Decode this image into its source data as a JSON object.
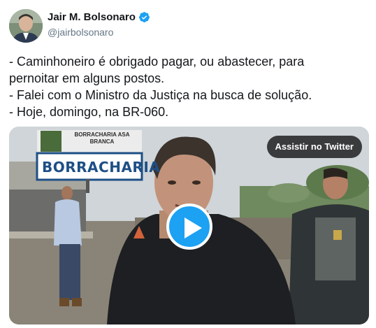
{
  "author": {
    "name": "Jair M. Bolsonaro",
    "handle": "@jairbolsonaro",
    "verified_color": "#1da1f2"
  },
  "tweet": {
    "lines": [
      "- Caminhoneiro é obrigado pagar, ou abastecer, para",
      "pernoitar em alguns postos.",
      "- Falei com o Ministro da Justiça na busca de solução.",
      "- Hoje, domingo, na BR-060."
    ]
  },
  "media": {
    "watch_label": "Assistir no Twitter",
    "sign_label": "BORRACHARIA",
    "sign_top": "BORRACHARIA ASA BRANCA",
    "play_color": "#1da1f2"
  }
}
